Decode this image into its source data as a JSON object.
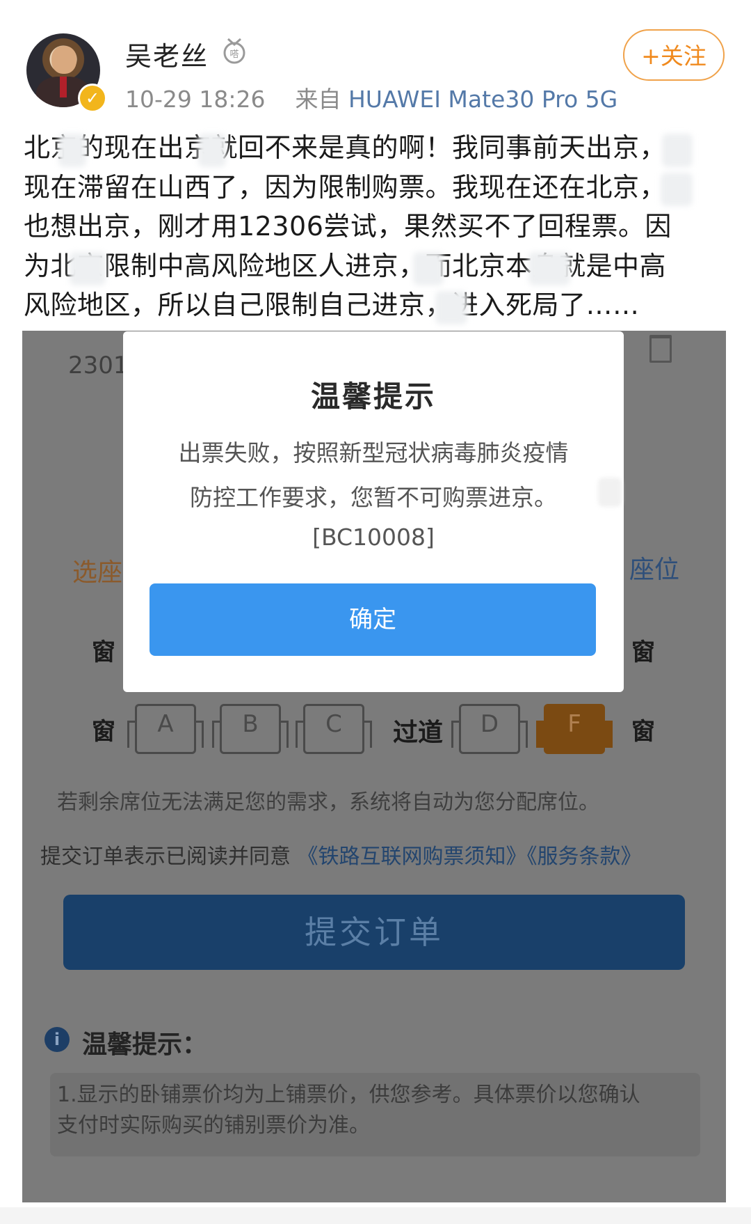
{
  "post": {
    "username": "吴老丝",
    "timestamp": "10-29 18:26",
    "source_prefix": "来自",
    "source_device": "HUAWEI Mate30 Pro 5G",
    "follow_label": "+关注",
    "text_lines": [
      "北京的现在出京就回不来是真的啊！我同事前天出京，",
      "现在滞留在山西了，因为限制购票。我现在还在北京，",
      "也想出京，刚才用12306尝试，果然买不了回程票。因",
      "为北京限制中高风险地区人进京，而北京本身就是中高",
      "风险地区，所以自己限制自己进京，进入死局了……"
    ]
  },
  "screenshot": {
    "order_number": "2301",
    "select_seat_label": "选座",
    "seat_label_right": "座位",
    "window_label": "窗",
    "aisle_label": "过道",
    "seats": [
      "A",
      "B",
      "C",
      "D",
      "F"
    ],
    "selected_seat": "F",
    "auto_assign_hint": "若剩余席位无法满足您的需求，系统将自动为您分配席位。",
    "agreement_prefix": "提交订单表示已阅读并同意",
    "agreement_link1": "《铁路互联网购票须知》",
    "agreement_link2": "《服务条款》",
    "submit_label": "提交订单",
    "tips_title": "温馨提示：",
    "tip_line1": "1.显示的卧铺票价均为上铺票价，供您参考。具体票价以您确认",
    "tip_line2": "支付时实际购买的铺别票价为准。"
  },
  "dialog": {
    "title": "温馨提示",
    "line1": "出票失败，按照新型冠状病毒肺炎疫情",
    "line2": "防控工作要求，您暂不可购票进京。",
    "code": "[BC10008]",
    "confirm_label": "确定"
  },
  "colors": {
    "follow_orange": "#f08a1e",
    "source_blue": "#5479a8",
    "dialog_button_blue": "#3a96ef",
    "overlay_gray": "#7b7b7b",
    "submit_button": "#19406a",
    "selected_seat": "#7b4a12"
  }
}
